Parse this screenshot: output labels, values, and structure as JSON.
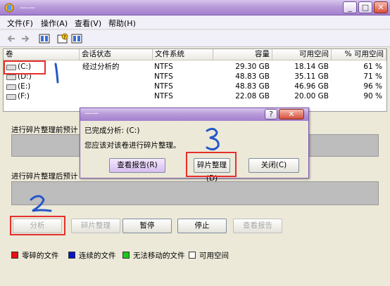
{
  "window": {
    "title": "——"
  },
  "caption_buttons": {
    "minimize": "_",
    "maximize": "□",
    "close": "✕"
  },
  "menu": [
    "文件(F)",
    "操作(A)",
    "查看(V)",
    "帮助(H)"
  ],
  "toolbar_icons": [
    "back-arrow-icon",
    "forward-arrow-icon",
    "view-icon",
    "help-icon",
    "properties-icon"
  ],
  "table": {
    "columns": [
      "卷",
      "会话状态",
      "文件系统",
      "容量",
      "可用空间",
      "% 可用空间"
    ],
    "rows": [
      {
        "volume": "(C:)",
        "status": "经过分析的",
        "fs": "NTFS",
        "capacity": "29.30 GB",
        "free": "18.14 GB",
        "pct": "61 %"
      },
      {
        "volume": "(D:)",
        "status": "",
        "fs": "NTFS",
        "capacity": "48.83 GB",
        "free": "35.11 GB",
        "pct": "71 %"
      },
      {
        "volume": "(E:)",
        "status": "",
        "fs": "NTFS",
        "capacity": "48.83 GB",
        "free": "46.96 GB",
        "pct": "96 %"
      },
      {
        "volume": "(F:)",
        "status": "",
        "fs": "NTFS",
        "capacity": "22.08 GB",
        "free": "20.00 GB",
        "pct": "90 %"
      }
    ]
  },
  "sections": {
    "before": "进行碎片整理前预计",
    "after": "进行碎片整理后预计"
  },
  "buttons": {
    "analyze": "分析",
    "defrag": "碎片整理",
    "pause": "暂停",
    "stop": "停止",
    "report": "查看报告"
  },
  "legend": [
    {
      "label": "零碎的文件",
      "color": "#e81010"
    },
    {
      "label": "连续的文件",
      "color": "#0a14c8"
    },
    {
      "label": "无法移动的文件",
      "color": "#18c818"
    },
    {
      "label": "可用空间",
      "color": "#ffffff"
    }
  ],
  "dialog": {
    "title": "——",
    "line1": "已完成分析: (C:)",
    "line2": "您应该对该卷进行碎片整理。",
    "btn_report": "查看报告(R)",
    "btn_defrag": "碎片整理(D)",
    "btn_close": "关闭(C)",
    "help": "?",
    "close": "✕"
  },
  "annotations": {
    "one": "1",
    "two": "2",
    "three": "3"
  }
}
